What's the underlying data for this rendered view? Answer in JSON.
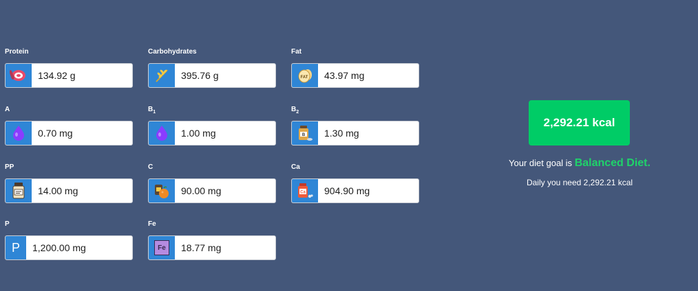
{
  "nutrients": {
    "protein": {
      "label": "Protein",
      "value": "134.92 g",
      "icon": "meat-icon"
    },
    "carbohydrates": {
      "label": "Carbohydrates",
      "value": "395.76 g",
      "icon": "wheat-icon"
    },
    "fat": {
      "label": "Fat",
      "value": "43.97 mg",
      "icon": "fat-egg-icon"
    },
    "a": {
      "label": "A",
      "value": "0.70 mg",
      "icon": "vitamin-drop-icon"
    },
    "b1": {
      "label": "B",
      "sub": "1",
      "value": "1.00 mg",
      "icon": "vitamin-drop-icon"
    },
    "b2": {
      "label": "B",
      "sub": "2",
      "value": "1.30 mg",
      "icon": "vitamin-bottle-icon"
    },
    "pp": {
      "label": "PP",
      "value": "14.00 mg",
      "icon": "supplement-jar-icon"
    },
    "c": {
      "label": "C",
      "value": "90.00 mg",
      "icon": "vitamin-c-orange-icon"
    },
    "ca": {
      "label": "Ca",
      "value": "904.90 mg",
      "icon": "calcium-bottle-icon"
    },
    "p": {
      "label": "P",
      "value": "1,200.00 mg",
      "icon": "phosphorus-letter-icon",
      "icon_text": "P"
    },
    "fe": {
      "label": "Fe",
      "value": "18.77 mg",
      "icon": "iron-element-icon",
      "icon_text": "Fe"
    }
  },
  "summary": {
    "kcal_button": "2,292.21 kcal",
    "goal_prefix": "Your diet goal is",
    "goal_value": "Balanced Diet.",
    "daily_need": "Daily you need 2,292.21 kcal"
  },
  "colors": {
    "background": "#44577a",
    "icon_bg": "#2f86d6",
    "accent_green": "#00cc66",
    "goal_green": "#1fd36a"
  }
}
